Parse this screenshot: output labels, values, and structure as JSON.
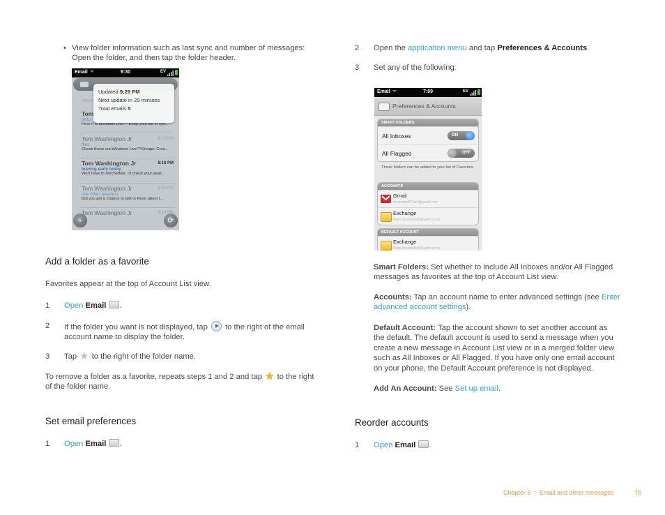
{
  "left": {
    "bullet": {
      "line1": "View folder information such as last sync and number of messages:",
      "line2": "Open the folder, and then tap the folder header."
    },
    "screenshot1": {
      "status": {
        "app": "Email",
        "time": "9:30",
        "network": "EV"
      },
      "popup": {
        "updated_label": "Updated ",
        "updated_time": "9:29 PM",
        "next_update": "Next update in 29 minutes",
        "total_label": "Total emails ",
        "total_value": "5"
      },
      "messages": [
        {
          "sender": "Tom",
          "time": "",
          "subject": "pictu",
          "snippet": "Here it is.Windows Live™:Keep your life in syn...",
          "unread": true
        },
        {
          "sender": "Tom Washington Jr",
          "time": "8:20 PM",
          "subject": "files",
          "snippet": "Check these out.Windows Live™Groups: Crea...",
          "unread": false
        },
        {
          "sender": "Tom Washington Jr",
          "time": "8:18 PM",
          "subject": "leaving early today",
          "snippet": "We'll have to reschedule. I'll check your avail...",
          "unread": true
        },
        {
          "sender": "Tom Washington Jr",
          "time": "8:15 PM",
          "subject": "one other question",
          "snippet": "Did you get a chance to talk to Rose about t...",
          "unread": false
        },
        {
          "sender": "Tom Washington Jr",
          "time": "8:14 PM",
          "subject": "",
          "snippet": "",
          "unread": false
        }
      ]
    },
    "section1": {
      "heading": "Add a folder as a favorite",
      "intro": "Favorites appear at the top of Account List view.",
      "steps": [
        {
          "num": "1",
          "link": "Open",
          "bold": "Email",
          "end": "."
        },
        {
          "num": "2",
          "pre": "If the folder you want is not displayed, tap",
          "post": "to the right of the email",
          "line2": "account name to display the folder."
        },
        {
          "num": "3",
          "pre": "Tap",
          "post": "to the right of the folder name."
        }
      ],
      "note_pre": "To remove a folder as a favorite, repeats steps 1 and 2 and tap",
      "note_post": "to the right",
      "note_line2": "of the folder name."
    },
    "section2": {
      "heading": "Set email preferences",
      "step1": {
        "num": "1",
        "link": "Open",
        "bold": "Email",
        "end": "."
      }
    }
  },
  "right": {
    "step2": {
      "num": "2",
      "pre": "Open the ",
      "link": "application menu",
      "mid": " and tap ",
      "bold": "Preferences & Accounts",
      "end": "."
    },
    "step3": {
      "num": "3",
      "text": "Set any of the following:"
    },
    "screenshot2": {
      "status": {
        "app": "Email",
        "time": "7:09",
        "network": "EV"
      },
      "header": "Preferences & Accounts",
      "smart_folders": {
        "title": "SMART FOLDERS",
        "rows": [
          {
            "label": "All Inboxes",
            "toggle": "ON"
          },
          {
            "label": "All Flagged",
            "toggle": "OFF"
          }
        ],
        "note": "These folders can be added to your list of Favorites"
      },
      "accounts": {
        "title": "ACCOUNTS",
        "rows": [
          {
            "name": "Gmail",
            "detail": "mcampbell72six@gmail.com"
          },
          {
            "name": "Exchange",
            "detail": "Palm (mcampbell@palm.com)"
          }
        ]
      },
      "default_account": {
        "title": "DEFAULT ACCOUNT",
        "rows": [
          {
            "name": "Exchange",
            "detail": "Palm (mcampbell@palm.com)"
          }
        ]
      }
    },
    "defs": [
      {
        "term": "Smart Folders:",
        "lines": [
          " Set whether to include All Inboxes and/or All Flagged",
          "messages as favorites at the top of Account List view."
        ]
      },
      {
        "term": "Accounts:",
        "line1": " Tap an account name to enter advanced settings (see ",
        "link1": "Enter",
        "link2": "advanced account settings",
        "end": ")."
      },
      {
        "term": "Default Account:",
        "lines": [
          " Tap the account shown to set another account as",
          "the default. The default account is used to send a message when you",
          "create a new message in Account List view or in a merged folder view",
          "such as All Inboxes or All Flagged. If you have only one email account",
          "on your phone, the Default Account preference is not displayed."
        ]
      },
      {
        "term": "Add An Account:",
        "pre": " See ",
        "link": "Set up email",
        "end": "."
      }
    ],
    "section3": {
      "heading": "Reorder accounts",
      "step1": {
        "num": "1",
        "link": "Open",
        "bold": "Email",
        "end": "."
      }
    }
  },
  "footer": {
    "chapter": "Chapter 5  :  Email and other messages",
    "page": "75",
    "color": "#f29a45"
  },
  "colors": {
    "link": "#2aa7d6",
    "text": "#4a4a4a"
  }
}
